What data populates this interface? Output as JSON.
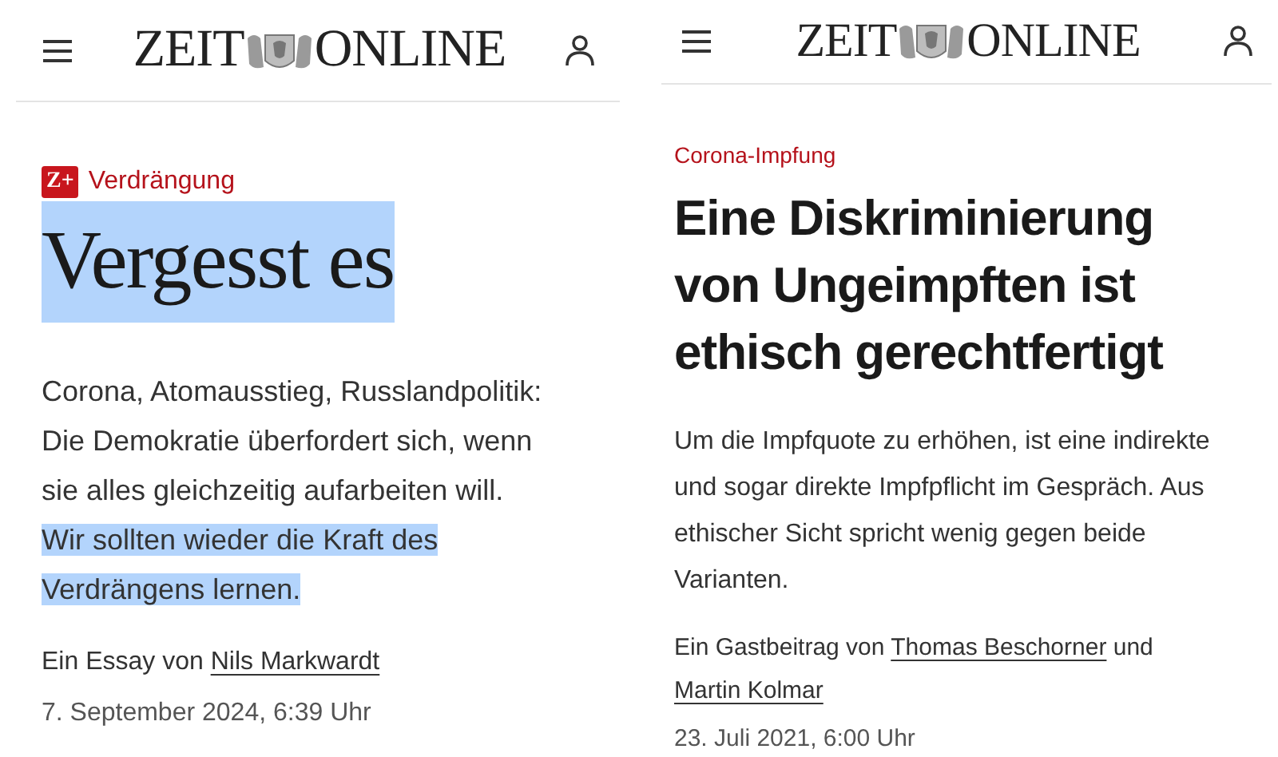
{
  "articles": [
    {
      "logo": {
        "left": "ZEIT",
        "right": "ONLINE"
      },
      "badge": "Z+",
      "kicker": "Verdrängung",
      "kind": "serif",
      "headline": "Vergesst es",
      "headline_highlighted": true,
      "teaser": [
        {
          "text": "Corona, Atomausstieg, Russlandpolitik:",
          "highlighted": false
        },
        {
          "text": "Die Demokratie überfordert sich, wenn",
          "highlighted": false
        },
        {
          "text": "sie alles gleichzeitig aufarbeiten will.",
          "highlighted": false
        },
        {
          "text": "Wir sollten wieder die Kraft des",
          "highlighted": true
        },
        {
          "text": "Verdrängens lernen.",
          "highlighted": true
        }
      ],
      "byline": [
        {
          "kind": "text",
          "text": "Ein Essay von "
        },
        {
          "kind": "link",
          "text": "Nils Markwardt"
        }
      ],
      "date": "7. September 2024, 6:39 Uhr"
    },
    {
      "logo": {
        "left": "ZEIT",
        "right": "ONLINE"
      },
      "kicker": "Corona-Impfung",
      "kind": "sans",
      "headline": "Eine Diskriminierung von Ungeimpften ist ethisch gerechtfertigt",
      "headline_highlighted": false,
      "teaser": [
        {
          "text": "Um die Impfquote zu erhöhen, ist eine indirekte und sogar direkte Impfpflicht im Gespräch. Aus ethischer Sicht spricht wenig gegen beide Varianten.",
          "highlighted": false
        }
      ],
      "byline": [
        {
          "kind": "text",
          "text": "Ein Gastbeitrag von "
        },
        {
          "kind": "link",
          "text": "Thomas Beschorner"
        },
        {
          "kind": "text",
          "text": " und "
        },
        {
          "kind": "link",
          "text": "Martin Kolmar"
        }
      ],
      "date": "23. Juli 2021, 6:00 Uhr"
    }
  ]
}
